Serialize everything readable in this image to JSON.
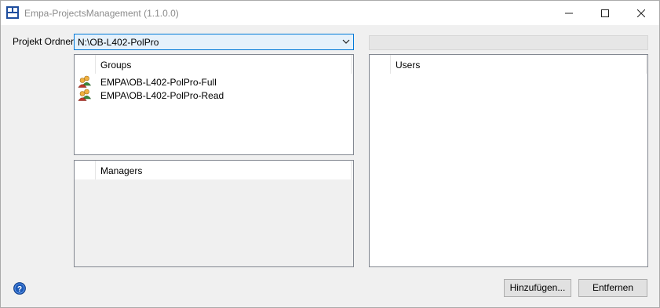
{
  "window": {
    "title": "Empa-ProjectsManagement (1.1.0.0)"
  },
  "form": {
    "folder_label": "Projekt Ordner:",
    "folder_value": "N:\\OB-L402-PolPro"
  },
  "groups": {
    "header": "Groups",
    "items": [
      {
        "label": "EMPA\\OB-L402-PolPro-Full",
        "icon": "user-group-icon"
      },
      {
        "label": "EMPA\\OB-L402-PolPro-Read",
        "icon": "user-group-icon"
      }
    ]
  },
  "managers": {
    "header": "Managers",
    "items": []
  },
  "users": {
    "header": "Users",
    "items": []
  },
  "buttons": {
    "add_label": "Hinzufügen...",
    "remove_label": "Entfernen"
  },
  "icons": {
    "app": "app-icon",
    "help": "help-icon",
    "dropdown": "chevron-down-icon"
  },
  "colors": {
    "accent": "#0078d7",
    "help_blue": "#1e5bb8"
  }
}
